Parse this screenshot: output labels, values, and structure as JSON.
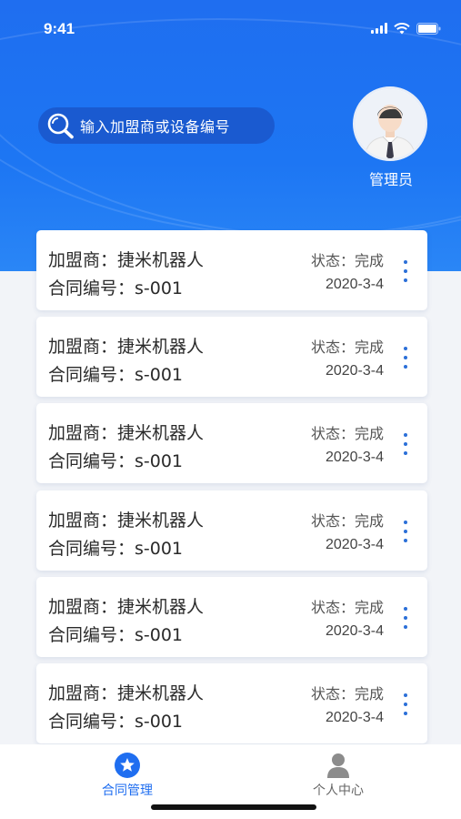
{
  "status_bar": {
    "time": "9:41"
  },
  "search": {
    "placeholder": "输入加盟商或设备编号",
    "icon": "search-icon"
  },
  "profile": {
    "role": "管理员",
    "avatar_icon": "user-avatar"
  },
  "contracts": [
    {
      "franchisee": "加盟商：捷米机器人",
      "contract_no": "合同编号：s-001",
      "status": "状态：完成",
      "date": "2020-3-4"
    },
    {
      "franchisee": "加盟商：捷米机器人",
      "contract_no": "合同编号：s-001",
      "status": "状态：完成",
      "date": "2020-3-4"
    },
    {
      "franchisee": "加盟商：捷米机器人",
      "contract_no": "合同编号：s-001",
      "status": "状态：完成",
      "date": "2020-3-4"
    },
    {
      "franchisee": "加盟商：捷米机器人",
      "contract_no": "合同编号：s-001",
      "status": "状态：完成",
      "date": "2020-3-4"
    },
    {
      "franchisee": "加盟商：捷米机器人",
      "contract_no": "合同编号：s-001",
      "status": "状态：完成",
      "date": "2020-3-4"
    },
    {
      "franchisee": "加盟商：捷米机器人",
      "contract_no": "合同编号：s-001",
      "status": "状态：完成",
      "date": "2020-3-4"
    }
  ],
  "tabbar": {
    "tabs": [
      {
        "label": "合同管理",
        "icon": "star-icon",
        "active": true
      },
      {
        "label": "个人中心",
        "icon": "person-icon",
        "active": false
      }
    ]
  },
  "colors": {
    "primary": "#1f6ef0",
    "search_bg": "#1a5ad0",
    "dots": "#2b6fd8"
  }
}
